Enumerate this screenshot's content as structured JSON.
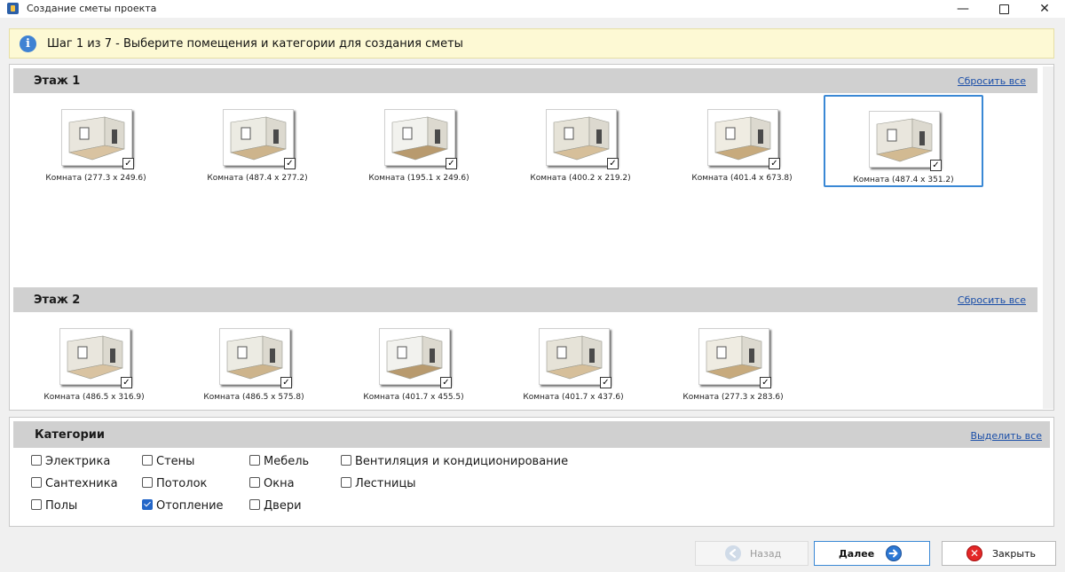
{
  "window": {
    "title": "Создание сметы проекта"
  },
  "banner": {
    "text": "Шаг 1 из 7 - Выберите помещения и категории для создания сметы"
  },
  "floors": [
    {
      "title": "Этаж 1",
      "reset_label": "Сбросить все",
      "rooms": [
        {
          "label": "Комната (277.3 x 249.6)",
          "checked": true,
          "selected": false
        },
        {
          "label": "Комната (487.4 x 277.2)",
          "checked": true,
          "selected": false
        },
        {
          "label": "Комната (195.1 x 249.6)",
          "checked": true,
          "selected": false
        },
        {
          "label": "Комната (400.2 x 219.2)",
          "checked": true,
          "selected": false
        },
        {
          "label": "Комната (401.4 x 673.8)",
          "checked": true,
          "selected": false
        },
        {
          "label": "Комната (487.4 x 351.2)",
          "checked": true,
          "selected": true
        }
      ]
    },
    {
      "title": "Этаж 2",
      "reset_label": "Сбросить все",
      "rooms": [
        {
          "label": "Комната (486.5 x 316.9)",
          "checked": true,
          "selected": false
        },
        {
          "label": "Комната (486.5 x 575.8)",
          "checked": true,
          "selected": false
        },
        {
          "label": "Комната (401.7 x 455.5)",
          "checked": true,
          "selected": false
        },
        {
          "label": "Комната (401.7 x 437.6)",
          "checked": true,
          "selected": false
        },
        {
          "label": "Комната (277.3 x 283.6)",
          "checked": true,
          "selected": false
        }
      ]
    }
  ],
  "categories": {
    "title": "Категории",
    "select_all_label": "Выделить все",
    "items": [
      {
        "label": "Электрика",
        "checked": false
      },
      {
        "label": "Сантехника",
        "checked": false
      },
      {
        "label": "Полы",
        "checked": false
      },
      {
        "label": "Стены",
        "checked": false
      },
      {
        "label": "Потолок",
        "checked": false
      },
      {
        "label": "Отопление",
        "checked": true
      },
      {
        "label": "Мебель",
        "checked": false
      },
      {
        "label": "Окна",
        "checked": false
      },
      {
        "label": "Двери",
        "checked": false
      },
      {
        "label": "Вентиляция и кондиционирование",
        "checked": false
      },
      {
        "label": "Лестницы",
        "checked": false
      }
    ]
  },
  "buttons": {
    "back_label": "Назад",
    "next_label": "Далее",
    "close_label": "Закрыть"
  },
  "colors": {
    "accent": "#3a88d5",
    "banner_bg": "#fdf9d4",
    "link": "#1a4ea8",
    "close_red": "#e32727"
  },
  "icons": [
    "info-icon",
    "back-arrow-icon",
    "next-arrow-icon",
    "close-x-icon"
  ]
}
